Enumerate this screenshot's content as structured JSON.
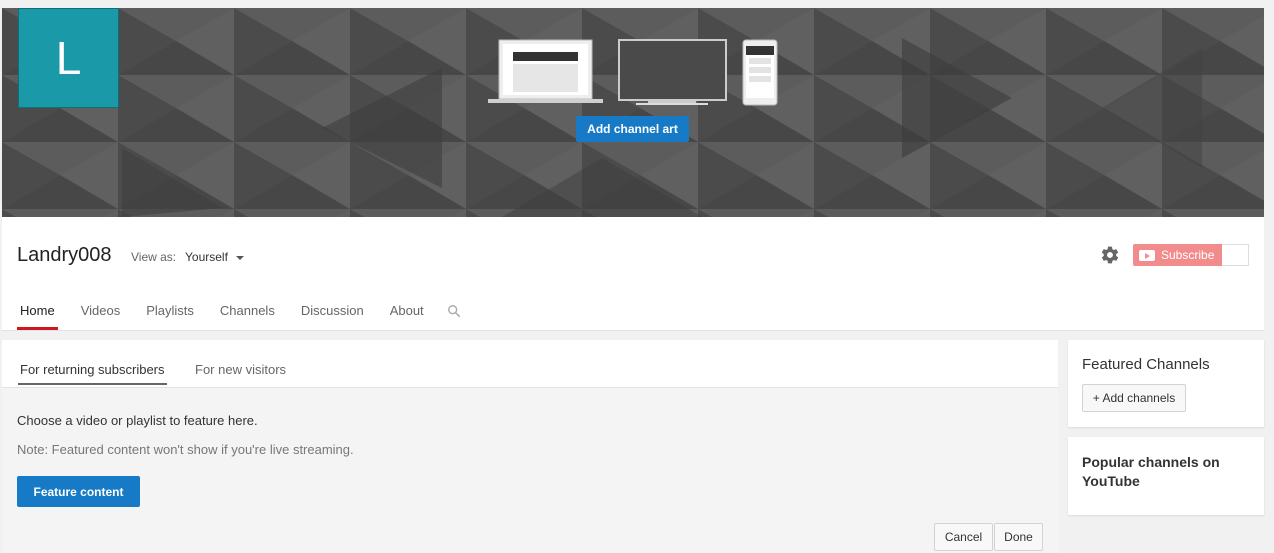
{
  "colors": {
    "accent_blue": "#167ac6",
    "avatar_bg": "#1a9aa8",
    "subscribe_bg": "#f28b8b",
    "active_tab_underline": "#cc181e"
  },
  "banner": {
    "avatar_letter": "L",
    "add_art_label": "Add channel art"
  },
  "header": {
    "channel_name": "Landry008",
    "view_as_label": "View as:",
    "view_as_value": "Yourself",
    "subscribe_label": "Subscribe",
    "tabs": [
      {
        "label": "Home",
        "active": true
      },
      {
        "label": "Videos"
      },
      {
        "label": "Playlists"
      },
      {
        "label": "Channels"
      },
      {
        "label": "Discussion"
      },
      {
        "label": "About"
      }
    ]
  },
  "main": {
    "subtabs": [
      {
        "label": "For returning subscribers",
        "active": true
      },
      {
        "label": "For new visitors"
      }
    ],
    "choose_text": "Choose a video or playlist to feature here.",
    "note_text": "Note: Featured content won't show if you're live streaming.",
    "feature_button": "Feature content",
    "cancel_button": "Cancel",
    "done_button": "Done"
  },
  "sidebar": {
    "featured_title": "Featured Channels",
    "add_channels_button": "+ Add channels",
    "popular_title": "Popular channels on YouTube"
  },
  "icons": [
    "settings-gear-icon",
    "search-icon",
    "youtube-play-icon",
    "caret-down-icon",
    "laptop-icon",
    "tv-icon",
    "phone-icon"
  ]
}
